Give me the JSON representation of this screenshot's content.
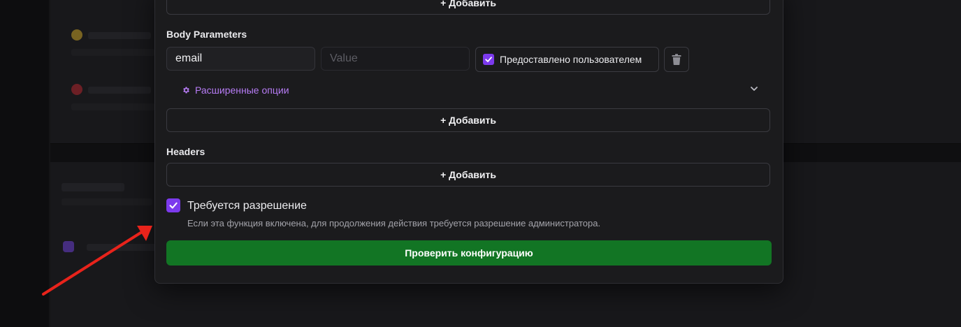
{
  "modal": {
    "add_label_top": "+ Добавить",
    "body_parameters": {
      "heading": "Body Parameters",
      "key_value": "email",
      "value_placeholder": "Value",
      "user_provided_label": "Предоставлено пользователем",
      "user_provided_checked": true,
      "advanced_options_label": "Расширенные опции",
      "add_label": "+ Добавить"
    },
    "headers": {
      "heading": "Headers",
      "add_label": "+ Добавить"
    },
    "permission": {
      "checked": true,
      "title": "Требуется разрешение",
      "description": "Если эта функция включена, для продолжения действия требуется разрешение администратора."
    },
    "verify_button_label": "Проверить конфигурацию"
  },
  "colors": {
    "accent_purple": "#7c3aed",
    "link_purple": "#b77cf5",
    "verify_green": "#127524",
    "annotation_arrow": "#e8231b"
  },
  "icons": [
    "check-icon",
    "trash-icon",
    "gear-icon",
    "chevron-down-icon",
    "arrow-annotation-icon"
  ]
}
